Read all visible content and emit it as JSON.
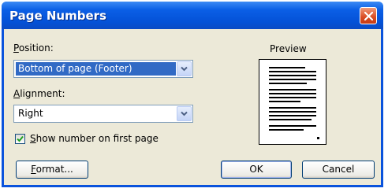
{
  "window": {
    "title": "Page Numbers",
    "close_icon": "close-icon"
  },
  "position": {
    "label_u": "P",
    "label_rest": "osition:",
    "selected": "Bottom of page (Footer)"
  },
  "alignment": {
    "label_u": "A",
    "label_rest": "lignment:",
    "selected": "Right"
  },
  "show_first": {
    "label_u": "S",
    "label_rest": "how number on first page",
    "checked": true
  },
  "preview": {
    "label": "Preview"
  },
  "buttons": {
    "format_u": "F",
    "format_rest": "ormat...",
    "ok": "OK",
    "cancel": "Cancel"
  },
  "colors": {
    "titlebar": "#0451d6",
    "close": "#d94b22",
    "selection": "#316ac5",
    "dialog_bg": "#ece9d8"
  }
}
